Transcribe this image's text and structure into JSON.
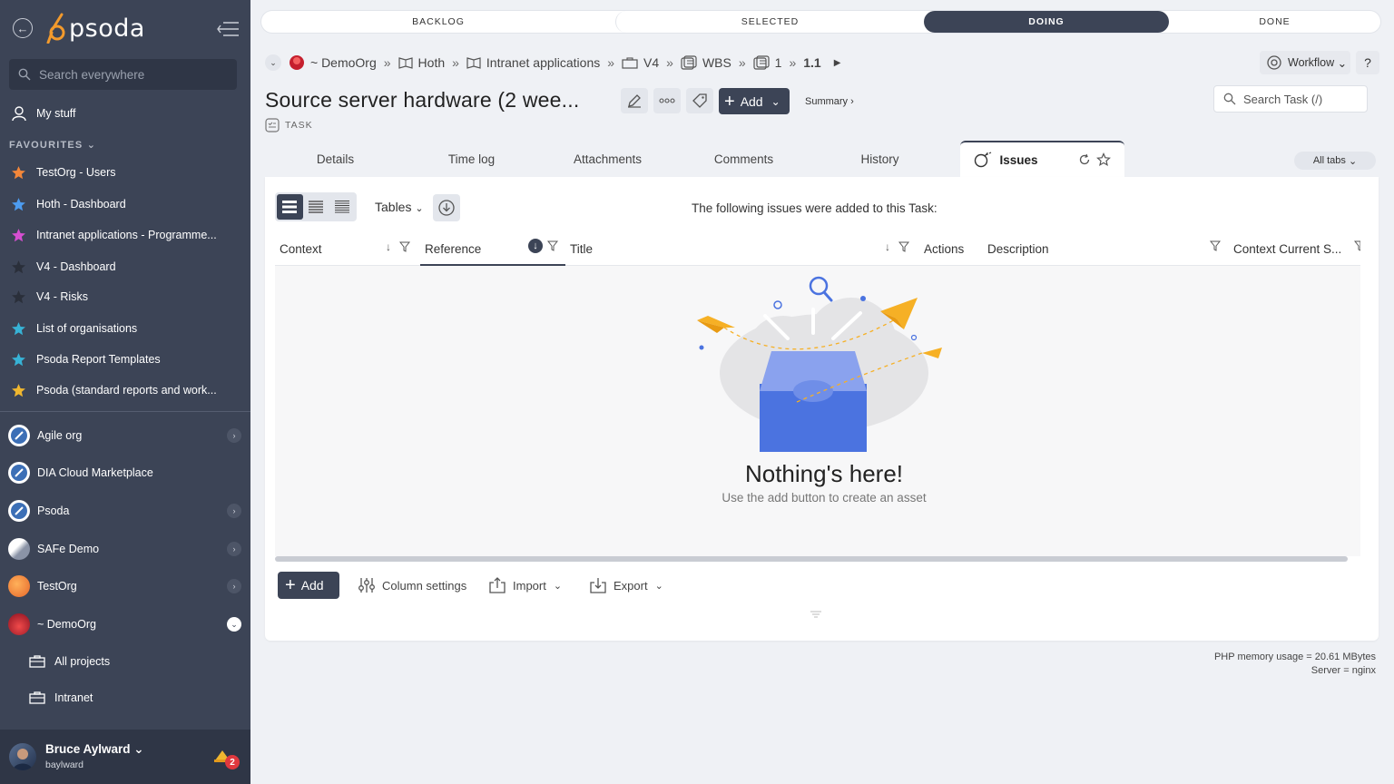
{
  "app": {
    "brand": "psoda",
    "accent": "#3c4456",
    "logo_orange": "#f39a2c"
  },
  "sidebar": {
    "search_placeholder": "Search everywhere",
    "my_stuff": "My stuff",
    "favourites_header": "FAVOURITES",
    "favourites": [
      {
        "label": "TestOrg - Users",
        "star_color": "#f3873a"
      },
      {
        "label": "Hoth - Dashboard",
        "star_color": "#4d9cf0"
      },
      {
        "label": "Intranet applications - Programme...",
        "star_color": "#d64fd1"
      },
      {
        "label": "V4 - Dashboard",
        "star_color": "#2a2f3a"
      },
      {
        "label": "V4 - Risks",
        "star_color": "#2a2f3a"
      },
      {
        "label": "List of organisations",
        "star_color": "#37b3d6"
      },
      {
        "label": "Psoda Report Templates",
        "star_color": "#37b3d6"
      },
      {
        "label": "Psoda (standard reports and work...",
        "star_color": "#f0b72f"
      }
    ],
    "orgs": [
      {
        "label": "Agile org"
      },
      {
        "label": "DIA Cloud Marketplace"
      },
      {
        "label": "Psoda"
      },
      {
        "label": "SAFe Demo"
      },
      {
        "label": "TestOrg"
      },
      {
        "label": "~ DemoOrg"
      }
    ],
    "sub_items": [
      {
        "label": "All projects"
      },
      {
        "label": "Intranet"
      }
    ],
    "user": {
      "name": "Bruce Aylward",
      "handle": "baylward",
      "notifications": "2"
    }
  },
  "stages": [
    {
      "label": "BACKLOG"
    },
    {
      "label": "SELECTED"
    },
    {
      "label": "DOING"
    },
    {
      "label": "DONE"
    }
  ],
  "breadcrumb": [
    {
      "label": "~ DemoOrg"
    },
    {
      "label": "Hoth"
    },
    {
      "label": "Intranet applications"
    },
    {
      "label": "V4"
    },
    {
      "label": "WBS"
    },
    {
      "label": "1"
    },
    {
      "label": "1.1"
    }
  ],
  "header": {
    "workflow_label": "Workflow",
    "help_label": "?",
    "title": "Source server hardware (2 wee...",
    "type_label": "TASK",
    "add_label": "Add",
    "summary_label": "Summary ›",
    "search_task_placeholder": "Search Task (/)"
  },
  "tabs": [
    {
      "label": "Details"
    },
    {
      "label": "Time log"
    },
    {
      "label": "Attachments"
    },
    {
      "label": "Comments"
    },
    {
      "label": "History"
    },
    {
      "label": "Issues"
    }
  ],
  "all_tabs_label": "All tabs",
  "panel": {
    "tables_label": "Tables",
    "message": "The following issues were added to this Task:",
    "columns": [
      {
        "label": "Context"
      },
      {
        "label": "Reference"
      },
      {
        "label": "Title"
      },
      {
        "label": "Actions"
      },
      {
        "label": "Description"
      },
      {
        "label": "Context Current S..."
      }
    ],
    "empty_title": "Nothing's here!",
    "empty_subtitle": "Use the add button to create an asset",
    "add_label": "Add",
    "column_settings_label": "Column settings",
    "import_label": "Import",
    "export_label": "Export"
  },
  "footer": {
    "memory": "PHP memory usage = 20.61 MBytes",
    "server": "Server = nginx"
  }
}
